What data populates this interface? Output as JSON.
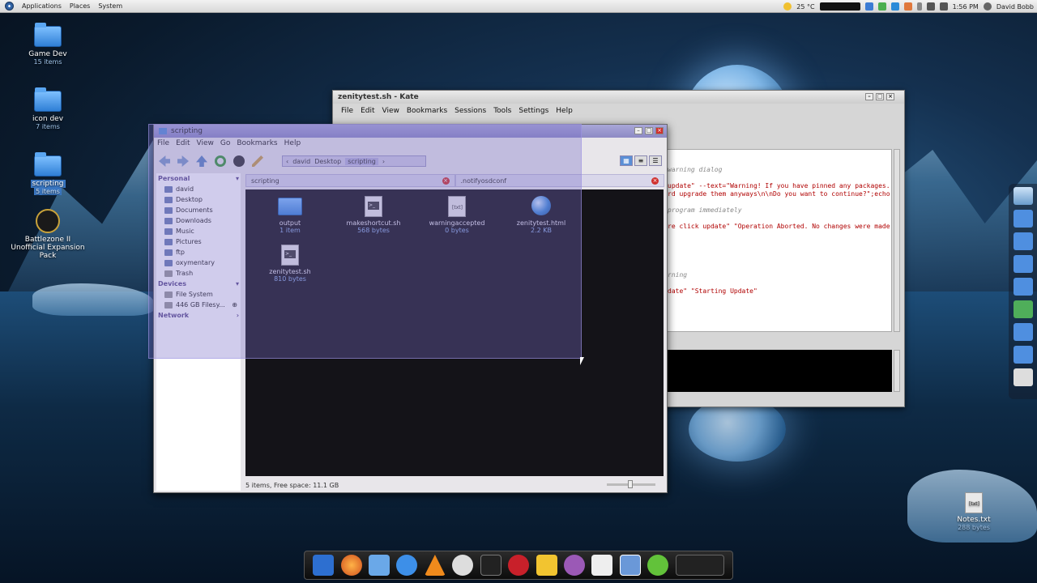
{
  "top_panel": {
    "menus": [
      "Applications",
      "Places",
      "System"
    ],
    "temperature": "25 °C",
    "time": "1:56 PM",
    "user": "David Bobb"
  },
  "desktop_icons": [
    {
      "label": "Game Dev",
      "sub": "15 items"
    },
    {
      "label": "icon dev",
      "sub": "7 items"
    },
    {
      "label": "scripting",
      "sub": "5 items"
    },
    {
      "label": "Battlezone II Unofficial Expansion Pack",
      "sub": ""
    },
    {
      "label": "Notes.txt",
      "sub": "288 bytes"
    }
  ],
  "kate": {
    "title": "zenitytest.sh - Kate",
    "menus": [
      "File",
      "Edit",
      "View",
      "Bookmarks",
      "Sessions",
      "Tools",
      "Settings",
      "Help"
    ],
    "code_lines": [
      {
        "text": "warning dialog",
        "style": "comment"
      },
      {
        "text": "update\" --text=\"Warning! If you have pinned any packages.",
        "style": "code"
      },
      {
        "text": "rd upgrade them anyways\\n\\nDo you want to continue?\";echo",
        "style": "code"
      },
      {
        "text": "program immediately",
        "style": "comment"
      },
      {
        "text": "re click update\" \"Operation Aborted. No changes were made",
        "style": "code"
      },
      {
        "text": "rning",
        "style": "comment"
      },
      {
        "text": "date\" \"Starting Update\"",
        "style": "code"
      }
    ]
  },
  "dolphin": {
    "title": "scripting",
    "menus": [
      "File",
      "Edit",
      "View",
      "Go",
      "Bookmarks",
      "Help"
    ],
    "breadcrumbs": [
      "david",
      "Desktop",
      "scripting"
    ],
    "sidebar": {
      "personal_header": "Personal",
      "personal": [
        "david",
        "Desktop",
        "Documents",
        "Downloads",
        "Music",
        "Pictures",
        "ftp",
        "oxymentary",
        "Trash"
      ],
      "devices_header": "Devices",
      "devices": [
        "File System",
        "446 GB Filesy..."
      ],
      "network_header": "Network"
    },
    "tabs": [
      "scripting",
      ".notifyosdconf"
    ],
    "files": [
      {
        "name": "output",
        "size": "1 item",
        "kind": "folder"
      },
      {
        "name": "makeshortcut.sh",
        "size": "568 bytes",
        "kind": "script"
      },
      {
        "name": "warningaccepted",
        "size": "0 bytes",
        "kind": "text"
      },
      {
        "name": "zenitytest.html",
        "size": "2.2 KB",
        "kind": "html"
      },
      {
        "name": "zenitytest.sh",
        "size": "810 bytes",
        "kind": "script"
      }
    ],
    "status": "5 items, Free space: 11.1 GB"
  },
  "dock_icons": [
    "anchor-icon",
    "firefox-icon",
    "thunderbird-icon",
    "drop-icon",
    "vlc-icon",
    "blender-icon",
    "terminal-icon",
    "mendeley-icon",
    "notes-icon",
    "purple-icon",
    "editor-icon",
    "files-icon",
    "skype-icon",
    "workspace-icon"
  ]
}
